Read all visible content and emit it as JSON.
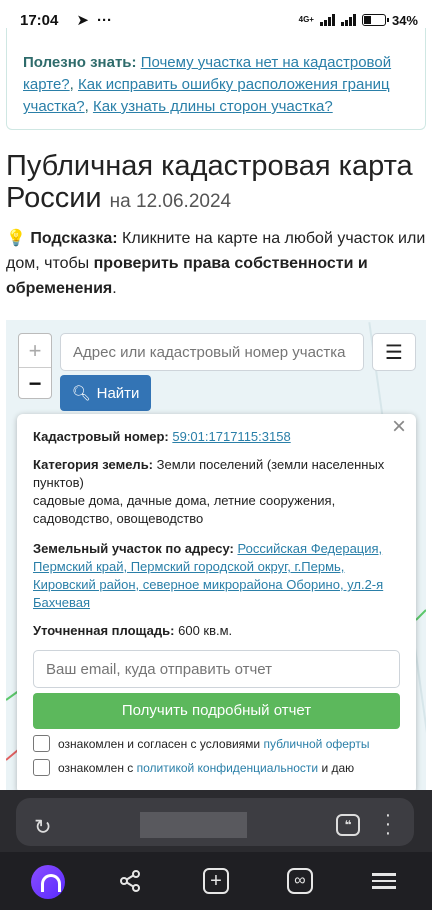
{
  "status_bar": {
    "time": "17:04",
    "net_label": "4G+",
    "battery": "34%",
    "battery_level": 0.34
  },
  "info_box": {
    "title": "Полезно знать:",
    "links": [
      "Почему участка нет на кадастровой карте?",
      "Как исправить ошибку расположения границ участка?",
      "Как узнать длины сторон участка?"
    ]
  },
  "page": {
    "title": "Публичная кадастровая карта России",
    "date": "на 12.06.2024"
  },
  "hint": {
    "label": "Подсказка:",
    "text": "Кликните на карте на любой участок или дом, чтобы",
    "bold": "проверить права собственности и обременения",
    "end": "."
  },
  "map": {
    "zoom_in": "+",
    "zoom_out": "−",
    "search_placeholder": "Адрес или кадастровый номер участка",
    "find_label": "Найти",
    "menu_icon": "menu-icon",
    "search_icon": "search-icon"
  },
  "popup": {
    "cad_label": "Кадастровый номер:",
    "cad_value": "59:01:1717115:3158",
    "category_label": "Категория земель:",
    "category_value": "Земли поселений (земли населенных пунктов)",
    "usage": "садовые дома, дачные дома, летние сооружения, садоводство, овощеводство",
    "address_label": "Земельный участок по адресу:",
    "address_value": "Российская Федерация, Пермский край, Пермский городской округ, г.Пермь, Кировский район, северное микрорайона Оборино, ул.2-я Бахчевая",
    "area_label": "Уточненная площадь:",
    "area_value": "600 кв.м.",
    "email_placeholder": "Ваш email, куда отправить отчет",
    "report_button": "Получить подробный отчет",
    "agree1_text": "ознакомлен и согласен с условиями",
    "agree1_link": "публичной оферты",
    "agree2_text": "ознакомлен с",
    "agree2_link": "политикой конфиденциальности",
    "agree2_tail": "и даю"
  },
  "browser": {
    "reload_icon": "reload-icon",
    "translate_icon": "translate-icon",
    "kebab_icon": "more-icon",
    "nav": [
      "alice-icon",
      "share-icon",
      "new-tab-icon",
      "tabs-icon",
      "menu-icon"
    ]
  }
}
